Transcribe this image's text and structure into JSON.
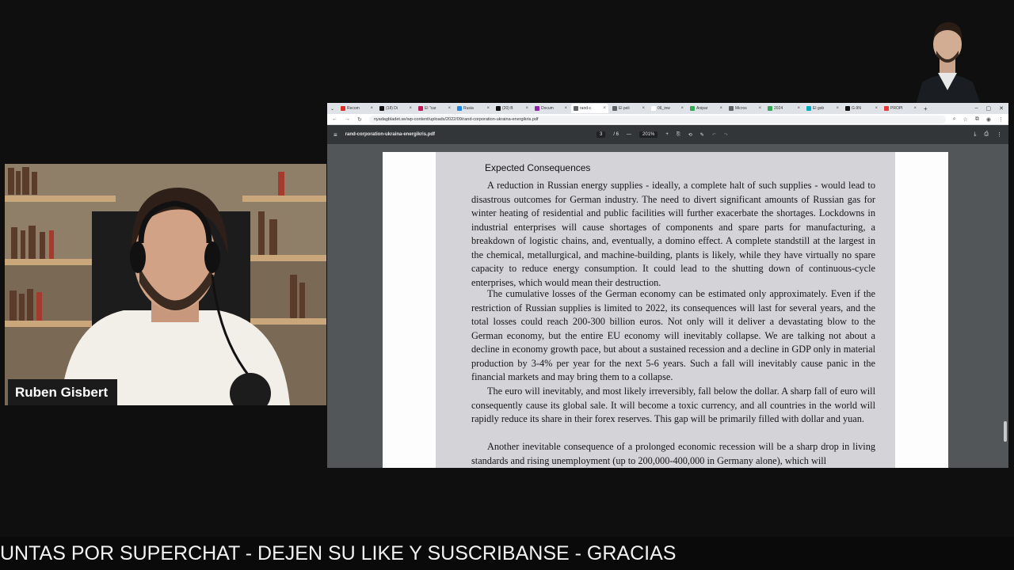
{
  "stream": {
    "speaker_name": "Ruben Gisbert",
    "ticker_text": "UNTAS POR SUPERCHAT - DEJEN SU LIKE Y SUSCRIBANSE - GRACIAS"
  },
  "browser": {
    "tabs": [
      {
        "label": "Recom",
        "color": "#d93025"
      },
      {
        "label": "(18) Di",
        "color": "#111111"
      },
      {
        "label": "El \"car",
        "color": "#c2185b"
      },
      {
        "label": "Rusia",
        "color": "#1e88e5"
      },
      {
        "label": "(20) B",
        "color": "#111111"
      },
      {
        "label": "Docum",
        "color": "#8e24aa"
      },
      {
        "label": "rand-c",
        "color": "#5f6368"
      },
      {
        "label": "El peli",
        "color": "#5f6368"
      },
      {
        "label": "06_inw",
        "color": "#ffffff"
      },
      {
        "label": "Anipar",
        "color": "#34a853"
      },
      {
        "label": "Micros",
        "color": "#5f6368"
      },
      {
        "label": "2024",
        "color": "#34a853"
      },
      {
        "label": "El gob",
        "color": "#00acc1"
      },
      {
        "label": "G-9N",
        "color": "#111111"
      },
      {
        "label": "PROPI",
        "color": "#e53935"
      }
    ],
    "active_tab_index": 6,
    "url": "nyadagbladet.se/wp-content/uploads/2022/09/rand-corporation-ukraina-energikris.pdf"
  },
  "pdf": {
    "filename": "rand-corporation-ukraina-energikris.pdf",
    "current_page": "3",
    "total_pages": "/  6",
    "zoom": "201%",
    "heading": "Expected Consequences",
    "paragraphs": [
      "A reduction in Russian energy supplies - ideally, a complete halt of such supplies - would lead to disastrous outcomes for German industry. The need to divert significant amounts of Russian gas for winter heating of residential and public facilities will further exacerbate the shortages. Lockdowns in industrial enterprises will cause shortages of components and spare parts for manufacturing, a breakdown of logistic chains, and, eventually, a domino effect. A complete standstill at the largest in the chemical, metallurgical, and machine-building, plants is likely, while they have virtually no spare capacity to reduce energy consumption. It could lead to the shutting down of continuous-cycle enterprises, which would mean their destruction.",
      "The cumulative losses of the German economy can be estimated only approximately. Even if the restriction of Russian supplies is limited to 2022, its consequences will last for several years, and the total losses could reach 200-300 billion euros. Not only will it deliver a devastating blow to the German economy, but the entire EU economy will inevitably collapse. We are talking not about a decline in economy growth pace, but about a sustained recession and a decline in GDP only in material production by 3-4% per year for the next 5-6 years. Such a fall will inevitably cause panic in the financial markets and may bring them to a collapse.",
      "The euro will inevitably, and most likely irreversibly, fall below the dollar. A sharp fall of euro will consequently cause its global sale. It will become a toxic currency, and all countries in the world will rapidly reduce its share in their forex reserves. This gap will be primarily filled with dollar and yuan.",
      "Another inevitable consequence of a prolonged economic recession will be a sharp drop in living standards and rising unemployment (up to 200,000-400,000 in Germany alone), which will"
    ]
  },
  "icons": {
    "toolbar": [
      "menu-icon",
      "zoom-out-icon",
      "zoom-in-icon",
      "fit-page-icon",
      "rotate-icon",
      "download-icon",
      "print-icon",
      "more-icon"
    ]
  }
}
